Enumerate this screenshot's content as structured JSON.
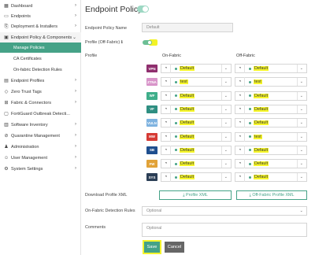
{
  "sidebar": {
    "items": [
      {
        "label": "Dashboard",
        "icon": "dashboard-icon"
      },
      {
        "label": "Endpoints",
        "icon": "endpoints-icon"
      },
      {
        "label": "Deployment & Installers",
        "icon": "deployment-icon"
      },
      {
        "label": "Endpoint Policy & Components",
        "icon": "policy-icon"
      },
      {
        "label": "Endpoint Profiles",
        "icon": "profiles-icon"
      },
      {
        "label": "Zero Trust Tags",
        "icon": "tag-icon"
      },
      {
        "label": "Fabric & Connectors",
        "icon": "fabric-icon"
      },
      {
        "label": "FortiGuard Outbreak Detecti...",
        "icon": "outbreak-icon"
      },
      {
        "label": "Software Inventory",
        "icon": "inventory-icon"
      },
      {
        "label": "Quarantine Management",
        "icon": "quarantine-icon"
      },
      {
        "label": "Administration",
        "icon": "admin-icon"
      },
      {
        "label": "User Management",
        "icon": "user-icon"
      },
      {
        "label": "System Settings",
        "icon": "gear-icon"
      }
    ],
    "sub_items": [
      "Manage Policies",
      "CA Certificates",
      "On-fabric Detection Rules"
    ]
  },
  "main": {
    "title": "Endpoint Policy",
    "policy_name_label": "Endpoint Policy Name",
    "policy_name_value": "Default",
    "profile_offfabric_label": "Profile (Off-Fabric)",
    "profile_label": "Profile",
    "col_on": "On-Fabric",
    "col_off": "Off-Fabric",
    "rows": [
      {
        "tag": "VPN",
        "color": "#8f2f6e",
        "on": "Default",
        "off": "Default"
      },
      {
        "tag": "ZTNA",
        "color": "#d894c9",
        "on": "test",
        "off": "test"
      },
      {
        "tag": "WF",
        "color": "#3fae8a",
        "on": "Default",
        "off": "Default"
      },
      {
        "tag": "VF",
        "color": "#2f8f82",
        "on": "Default",
        "off": "Default"
      },
      {
        "tag": "VULN",
        "color": "#7fb3e0",
        "on": "Default",
        "off": "Default"
      },
      {
        "tag": "MW",
        "color": "#d63b35",
        "on": "Default",
        "off": "test"
      },
      {
        "tag": "SB",
        "color": "#1f4f8f",
        "on": "Default",
        "off": "Default"
      },
      {
        "tag": "FW",
        "color": "#e1a238",
        "on": "Default",
        "off": "Default"
      },
      {
        "tag": "SYS",
        "color": "#2c3f56",
        "on": "Default",
        "off": "Default"
      }
    ],
    "download_label": "Download Profile XML",
    "profile_xml_btn": "Profile XML",
    "offfabric_xml_btn": "Off-Fabric Profile XML",
    "detection_label": "On-Fabric Detection Rules",
    "detection_placeholder": "Optional",
    "comments_label": "Comments",
    "comments_placeholder": "Optional",
    "save_label": "Save",
    "cancel_label": "Cancel"
  }
}
